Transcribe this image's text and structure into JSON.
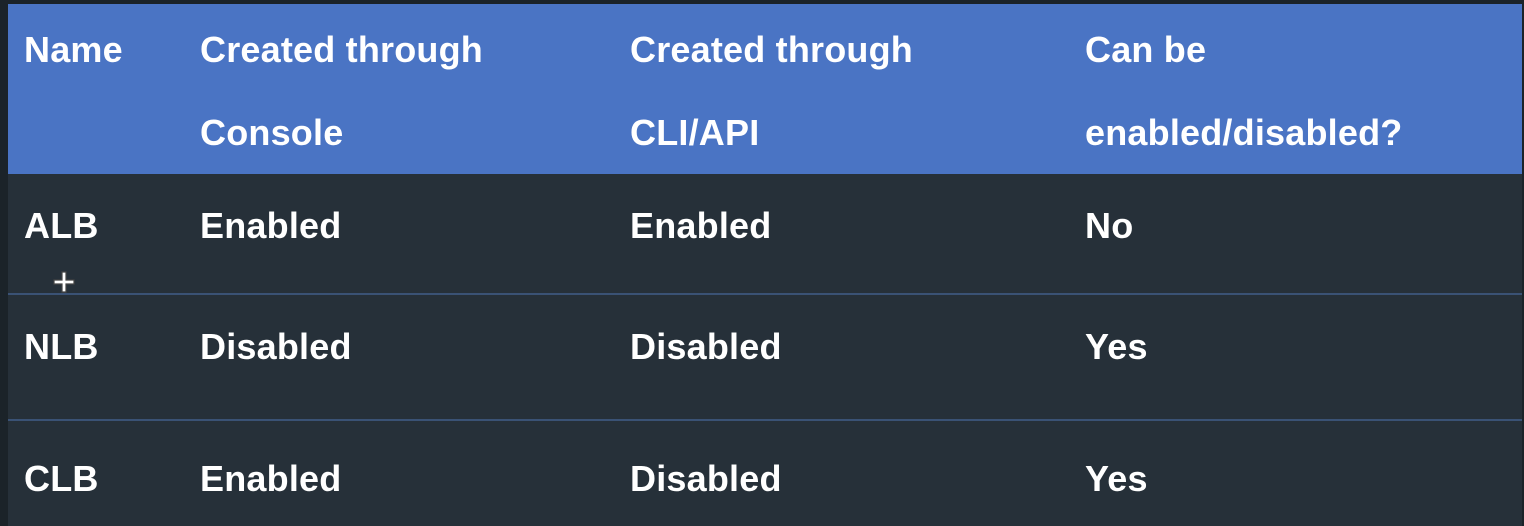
{
  "table": {
    "headers": [
      {
        "line1": "Name",
        "line2": ""
      },
      {
        "line1": "Created through",
        "line2": "Console"
      },
      {
        "line1": "Created through",
        "line2": "CLI/API"
      },
      {
        "line1": "Can be",
        "line2": "enabled/disabled?"
      }
    ],
    "rows": [
      {
        "name": "ALB",
        "console": "Enabled",
        "cli_api": "Enabled",
        "toggleable": "No"
      },
      {
        "name": "NLB",
        "console": "Disabled",
        "cli_api": "Disabled",
        "toggleable": "Yes"
      },
      {
        "name": "CLB",
        "console": "Enabled",
        "cli_api": "Disabled",
        "toggleable": "Yes"
      }
    ]
  },
  "colors": {
    "header_background": "#4a74c4",
    "row_background": "#263039",
    "row_divider": "#3a5275",
    "text": "#ffffff"
  },
  "icons": {
    "cursor": "crosshair-cursor-icon"
  }
}
